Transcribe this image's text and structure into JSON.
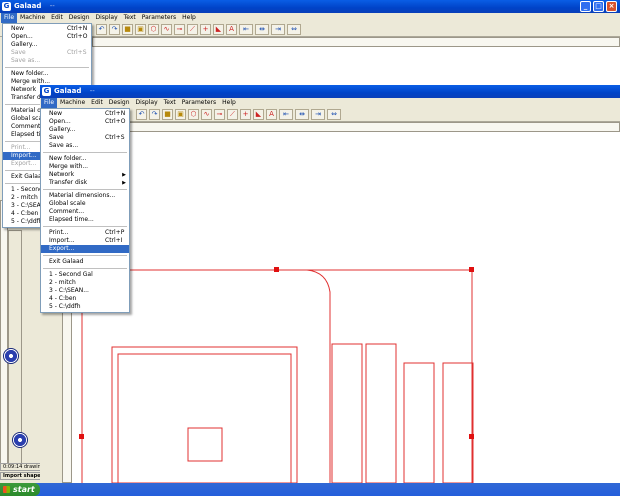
{
  "back_window": {
    "title": "Galaad",
    "title_extra": "--",
    "menu": [
      "File",
      "Machine",
      "Edit",
      "Design",
      "Display",
      "Text",
      "Parameters",
      "Help"
    ],
    "file_menu": [
      {
        "label": "New",
        "shortcut": "Ctrl+N"
      },
      {
        "label": "Open...",
        "shortcut": "Ctrl+O"
      },
      {
        "label": "Gallery..."
      },
      {
        "label": "Save",
        "shortcut": "Ctrl+S",
        "disabled": true
      },
      {
        "label": "Save as...",
        "disabled": true
      },
      {
        "sep": true
      },
      {
        "label": "New folder..."
      },
      {
        "label": "Merge with..."
      },
      {
        "label": "Network"
      },
      {
        "label": "Transfer disk"
      },
      {
        "sep": true
      },
      {
        "label": "Material dime"
      },
      {
        "label": "Global scale"
      },
      {
        "label": "Comment..."
      },
      {
        "label": "Elapsed time..."
      },
      {
        "sep": true
      },
      {
        "label": "Print...",
        "disabled": true
      },
      {
        "label": "Import...",
        "highlighted": true
      },
      {
        "label": "Export...",
        "disabled": true
      },
      {
        "sep": true
      },
      {
        "label": "Exit Galaad"
      },
      {
        "sep": true
      },
      {
        "label": "1 - Second Ga"
      },
      {
        "label": "2 - mitch"
      },
      {
        "label": "3 - C:\\SEAN..."
      },
      {
        "label": "4 - C:ben"
      },
      {
        "label": "5 - C:\\ddfh"
      }
    ],
    "status_time": "0:09:14 drawing",
    "status_label": "Import shapes"
  },
  "front_window": {
    "title": "Galaad",
    "title_extra": "--",
    "menu": [
      "File",
      "Machine",
      "Edit",
      "Design",
      "Display",
      "Text",
      "Parameters",
      "Help"
    ],
    "file_menu": [
      {
        "label": "New",
        "shortcut": "Ctrl+N"
      },
      {
        "label": "Open...",
        "shortcut": "Ctrl+O"
      },
      {
        "label": "Gallery..."
      },
      {
        "label": "Save",
        "shortcut": "Ctrl+S"
      },
      {
        "label": "Save as..."
      },
      {
        "sep": true
      },
      {
        "label": "New folder..."
      },
      {
        "label": "Merge with..."
      },
      {
        "label": "Network",
        "submenu": true
      },
      {
        "label": "Transfer disk",
        "submenu": true
      },
      {
        "sep": true
      },
      {
        "label": "Material dimensions..."
      },
      {
        "label": "Global scale"
      },
      {
        "label": "Comment..."
      },
      {
        "label": "Elapsed time..."
      },
      {
        "sep": true
      },
      {
        "label": "Print...",
        "shortcut": "Ctrl+P"
      },
      {
        "label": "Import...",
        "shortcut": "Ctrl+I"
      },
      {
        "label": "Export...",
        "highlighted": true
      },
      {
        "sep": true
      },
      {
        "label": "Exit Galaad"
      },
      {
        "sep": true
      },
      {
        "label": "1 - Second Gal"
      },
      {
        "label": "2 - mitch"
      },
      {
        "label": "3 - C:\\SEAN..."
      },
      {
        "label": "4 - C:ben"
      },
      {
        "label": "5 - C:\\ddfh"
      }
    ]
  },
  "taskbar": {
    "start_label": "start"
  },
  "colors": {
    "drawing": "#e03030",
    "handle": "#e01010",
    "highlight": "#316ac5"
  },
  "toolbar_icons": [
    "undo-icon",
    "redo-icon",
    "shapes-icon",
    "layers-icon",
    "polygon-icon",
    "curve-icon",
    "node-icon",
    "cross-icon",
    "crop-icon",
    "text-icon",
    "align-icon"
  ]
}
